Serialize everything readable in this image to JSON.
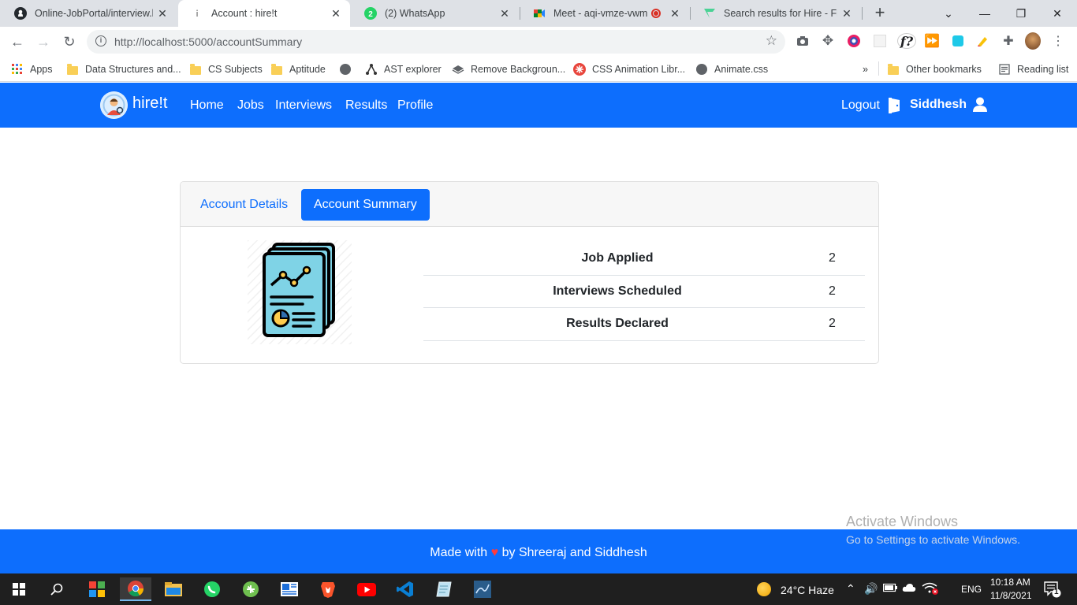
{
  "browser": {
    "tabs": [
      {
        "title": "Online-JobPortal/interview.h",
        "icon": "github-icon"
      },
      {
        "title": "Account : hire!t",
        "icon": "page-icon"
      },
      {
        "title": "(2) WhatsApp",
        "icon": "whatsapp-icon",
        "badge": "2"
      },
      {
        "title": "Meet - aqi-vmze-vwm",
        "icon": "meet-icon"
      },
      {
        "title": "Search results for Hire - Flat",
        "icon": "flaticon-icon"
      }
    ],
    "url": "http://localhost:5000/accountSummary",
    "bookmarks": [
      {
        "label": "Apps",
        "icon": "apps-grid-icon"
      },
      {
        "label": "Data Structures and...",
        "icon": "folder-icon"
      },
      {
        "label": "CS Subjects",
        "icon": "folder-icon"
      },
      {
        "label": "Aptitude",
        "icon": "folder-icon"
      },
      {
        "label": "",
        "icon": "globe-icon"
      },
      {
        "label": "AST explorer",
        "icon": "ast-icon"
      },
      {
        "label": "Remove Backgroun...",
        "icon": "layers-icon"
      },
      {
        "label": "CSS Animation Libr...",
        "icon": "css-anim-icon"
      },
      {
        "label": "Animate.css",
        "icon": "globe-icon"
      }
    ],
    "more_bookmarks": "»",
    "other_bookmarks": "Other bookmarks",
    "reading_list": "Reading list"
  },
  "navbar": {
    "brand": "hire!t",
    "links": [
      "Home",
      "Jobs",
      "Interviews",
      "Results",
      "Profile"
    ],
    "logout": "Logout",
    "user": "Siddhesh",
    "colors": {
      "primary": "#0d6efd"
    }
  },
  "card": {
    "tabs": [
      "Account Details",
      "Account Summary"
    ],
    "active_tab": "Account Summary",
    "stats": [
      {
        "label": "Job Applied",
        "value": "2"
      },
      {
        "label": "Interviews Scheduled",
        "value": "2"
      },
      {
        "label": "Results Declared",
        "value": "2"
      }
    ]
  },
  "footer": {
    "prefix": "Made with",
    "heart": "♥",
    "suffix": "by Shreeraj and Siddhesh"
  },
  "watermark": {
    "title": "Activate Windows",
    "subtitle": "Go to Settings to activate Windows."
  },
  "taskbar": {
    "weather": "24°C  Haze",
    "language": "ENG",
    "time": "10:18 AM",
    "date": "11/8/2021",
    "notifications": "1"
  }
}
